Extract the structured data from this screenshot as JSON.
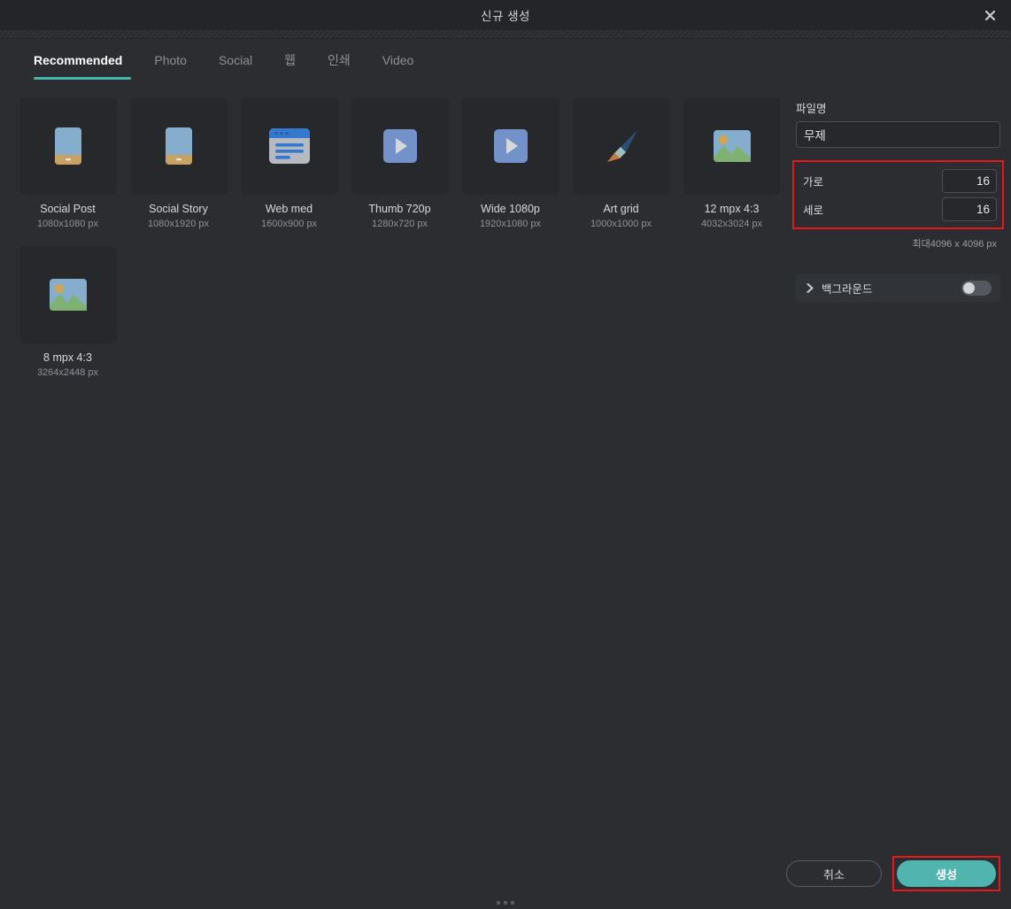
{
  "window": {
    "title": "신규 생성",
    "close_icon": "close-icon"
  },
  "tabs": [
    {
      "label": "Recommended",
      "active": true
    },
    {
      "label": "Photo",
      "active": false
    },
    {
      "label": "Social",
      "active": false
    },
    {
      "label": "웹",
      "active": false
    },
    {
      "label": "인쇄",
      "active": false
    },
    {
      "label": "Video",
      "active": false
    }
  ],
  "templates": [
    {
      "name": "Social Post",
      "dims": "1080x1080 px",
      "icon": "phone-portrait-icon"
    },
    {
      "name": "Social Story",
      "dims": "1080x1920 px",
      "icon": "phone-portrait-icon"
    },
    {
      "name": "Web med",
      "dims": "1600x900 px",
      "icon": "browser-window-icon"
    },
    {
      "name": "Thumb 720p",
      "dims": "1280x720 px",
      "icon": "video-play-icon"
    },
    {
      "name": "Wide 1080p",
      "dims": "1920x1080 px",
      "icon": "video-play-icon"
    },
    {
      "name": "Art grid",
      "dims": "1000x1000 px",
      "icon": "paintbrush-icon"
    },
    {
      "name": "12 mpx 4:3",
      "dims": "4032x3024 px",
      "icon": "landscape-photo-icon"
    },
    {
      "name": "8 mpx 4:3",
      "dims": "3264x2448 px",
      "icon": "landscape-photo-icon"
    }
  ],
  "panel": {
    "filename_label": "파일명",
    "filename_value": "무제",
    "width_label": "가로",
    "width_value": "16",
    "height_label": "세로",
    "height_value": "16",
    "max_hint": "최대4096 x 4096 px",
    "background_label": "백그라운드",
    "background_enabled": false
  },
  "footer": {
    "cancel_label": "취소",
    "create_label": "생성"
  },
  "colors": {
    "accent_teal": "#4fb5ae",
    "highlight_red": "#e8181a",
    "dialog_bg": "#2b2d31",
    "card_bg": "#26282c"
  }
}
